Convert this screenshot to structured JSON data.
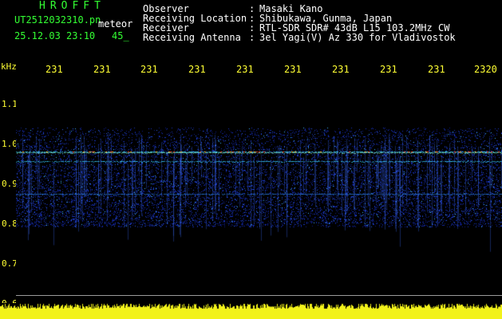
{
  "header": {
    "app_title": "HROFFT",
    "file_name": "UT2512032310.pn",
    "meteor_label": "meteor",
    "date_time": "25.12.03 23:10",
    "count": "45_"
  },
  "info": [
    {
      "label": "Observer",
      "sep": ":",
      "value": "Masaki Kano"
    },
    {
      "label": "Receiving Location",
      "sep": ":",
      "value": "Shibukawa, Gunma, Japan"
    },
    {
      "label": "Receiver",
      "sep": ":",
      "value": "RTL-SDR SDR# 43dB L15 103.2MHz CW"
    },
    {
      "label": "Receiving Antenna",
      "sep": ":",
      "value": "3el Yagi(V) Az 330 for Vladivostok"
    }
  ],
  "axis": {
    "unit": "kHz",
    "time_ticks": [
      "231",
      "231",
      "231",
      "231",
      "231",
      "231",
      "231",
      "231",
      "231",
      "2320"
    ],
    "freq_ticks": [
      "1.1",
      "1.0",
      "0.9",
      "0.8",
      "0.7",
      "0.6"
    ]
  },
  "colors": {
    "background": "#000000",
    "text_white": "#ffffff",
    "title_green": "#33ff33",
    "axis_yellow": "#ffff33",
    "signal_low": "#1a2fa8",
    "signal_mid": "#38c8ff",
    "signal_high": "#ff4020"
  }
}
